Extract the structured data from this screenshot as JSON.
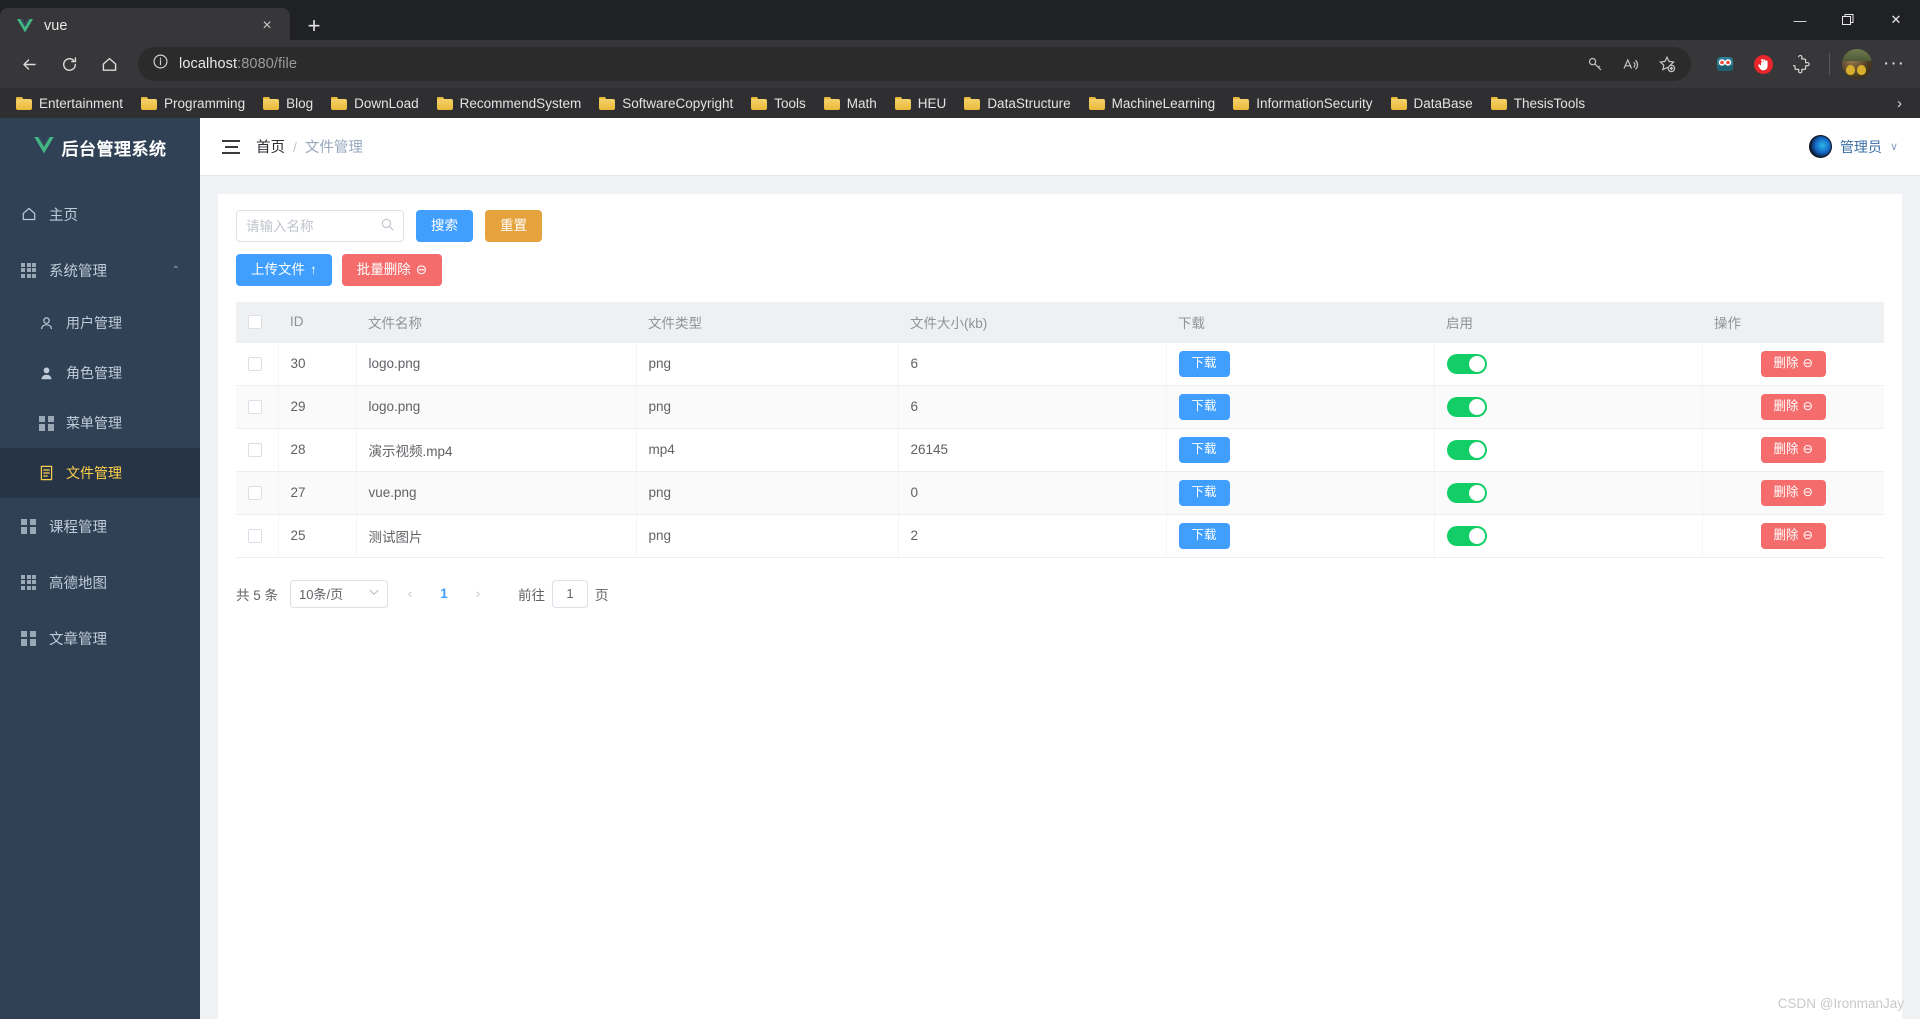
{
  "browser": {
    "tab": {
      "title": "vue",
      "favicon": "vue-logo-icon",
      "close_label": "×"
    },
    "new_tab_label": "+",
    "window_controls": {
      "minimize": "—",
      "maximize": "❐",
      "close": "✕"
    },
    "nav": {
      "back": "←",
      "reload": "↻",
      "home": "⌂"
    },
    "omnibox": {
      "info_icon": "info-icon",
      "url_host": "localhost",
      "url_rest": ":8080/file"
    },
    "omnibox_icons": [
      "key-icon",
      "read-aloud-icon",
      "add-favorite-icon"
    ],
    "extensions": [
      "collections-robot-icon",
      "adblock-icon",
      "extension-puzzle-icon"
    ],
    "profile": "profile-avatar",
    "settings_more": "···",
    "bookmarks": [
      "Entertainment",
      "Programming",
      "Blog",
      "DownLoad",
      "RecommendSystem",
      "SoftwareCopyright",
      "Tools",
      "Math",
      "HEU",
      "DataStructure",
      "MachineLearning",
      "InformationSecurity",
      "DataBase",
      "ThesisTools"
    ],
    "bookmarks_overflow": "›"
  },
  "sidebar": {
    "logo_text": "后台管理系统",
    "items": [
      {
        "label": "主页",
        "icon": "home-icon",
        "type": "item"
      },
      {
        "label": "系统管理",
        "icon": "grid9-icon",
        "type": "group",
        "caret": "⌃"
      },
      {
        "label": "用户管理",
        "icon": "user-outline-icon",
        "type": "sub"
      },
      {
        "label": "角色管理",
        "icon": "user-solid-icon",
        "type": "sub"
      },
      {
        "label": "菜单管理",
        "icon": "grid4-icon",
        "type": "sub"
      },
      {
        "label": "文件管理",
        "icon": "document-icon",
        "type": "sub",
        "active": true
      },
      {
        "label": "课程管理",
        "icon": "grid4-icon",
        "type": "item"
      },
      {
        "label": "高德地图",
        "icon": "grid9-icon",
        "type": "item"
      },
      {
        "label": "文章管理",
        "icon": "grid4-icon",
        "type": "item"
      }
    ]
  },
  "topbar": {
    "menu_toggle": "hamburger-icon",
    "breadcrumb_home": "首页",
    "breadcrumb_sep": "/",
    "breadcrumb_current": "文件管理",
    "user_name": "管理员",
    "user_chevron": "∨"
  },
  "toolbar": {
    "search_placeholder": "请输入名称",
    "search_value": "",
    "search_button": "搜索",
    "reset_button": "重置",
    "upload_button": "上传文件",
    "upload_icon": "↑",
    "batch_delete_button": "批量删除",
    "batch_delete_icon": "⊖"
  },
  "table": {
    "columns": [
      "",
      "ID",
      "文件名称",
      "文件类型",
      "文件大小(kb)",
      "下载",
      "启用",
      "操作"
    ],
    "download_label": "下载",
    "delete_label": "删除",
    "delete_icon": "⊖",
    "rows": [
      {
        "id": "30",
        "name": "logo.png",
        "type": "png",
        "size": "6",
        "enabled": true
      },
      {
        "id": "29",
        "name": "logo.png",
        "type": "png",
        "size": "6",
        "enabled": true
      },
      {
        "id": "28",
        "name": "演示视频.mp4",
        "type": "mp4",
        "size": "26145",
        "enabled": true
      },
      {
        "id": "27",
        "name": "vue.png",
        "type": "png",
        "size": "0",
        "enabled": true
      },
      {
        "id": "25",
        "name": "测试图片",
        "type": "png",
        "size": "2",
        "enabled": true
      }
    ]
  },
  "pagination": {
    "total_text": "共 5 条",
    "page_size": "10条/页",
    "prev": "‹",
    "current_page": "1",
    "next": "›",
    "goto_label": "前往",
    "goto_value": "1",
    "page_unit": "页"
  },
  "watermark": "CSDN @IronmanJay",
  "colors": {
    "sidebar_bg": "#304156",
    "sidebar_active_bg": "#263445",
    "sidebar_active_text": "#ffd04b",
    "primary": "#409eff",
    "warning": "#e6a23c",
    "danger": "#f56c6c",
    "switch_on": "#13ce66"
  }
}
